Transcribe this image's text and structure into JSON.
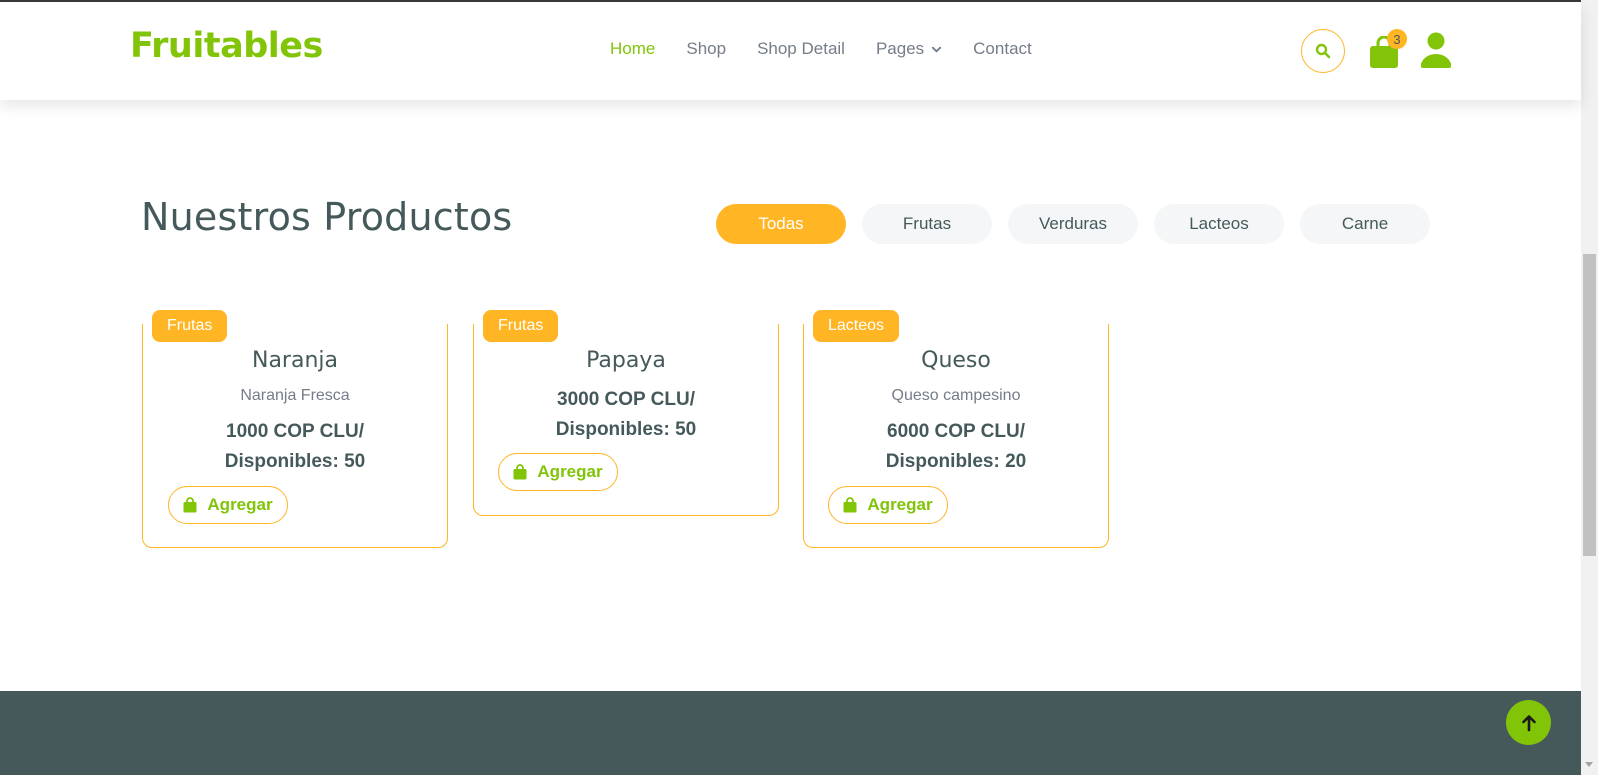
{
  "brand": "Fruitables",
  "nav": {
    "links": [
      "Home",
      "Shop",
      "Shop Detail",
      "Pages",
      "Contact"
    ],
    "active": "Home",
    "cart_count": "3"
  },
  "section": {
    "title": "Nuestros Productos",
    "filters": [
      "Todas",
      "Frutas",
      "Verduras",
      "Lacteos",
      "Carne"
    ],
    "active_filter": "Todas"
  },
  "products": [
    {
      "tag": "Frutas",
      "name": "Naranja",
      "description": "Naranja Fresca",
      "price_line": "1000 COP CLU/",
      "stock_line": "Disponibles: 50",
      "button": "Agregar"
    },
    {
      "tag": "Frutas",
      "name": "Papaya",
      "description": "",
      "price_line": "3000 COP CLU/",
      "stock_line": "Disponibles: 50",
      "button": "Agregar"
    },
    {
      "tag": "Lacteos",
      "name": "Queso",
      "description": "Queso campesino",
      "price_line": "6000 COP CLU/",
      "stock_line": "Disponibles: 20",
      "button": "Agregar"
    }
  ],
  "colors": {
    "primary": "#81c408",
    "secondary": "#ffb524",
    "dark": "#45595b",
    "muted": "#747d88"
  },
  "icons": {
    "search": "search-icon",
    "cart": "shopping-bag-icon",
    "user": "user-icon",
    "back_to_top": "arrow-up-icon",
    "add": "shopping-bag-icon"
  }
}
